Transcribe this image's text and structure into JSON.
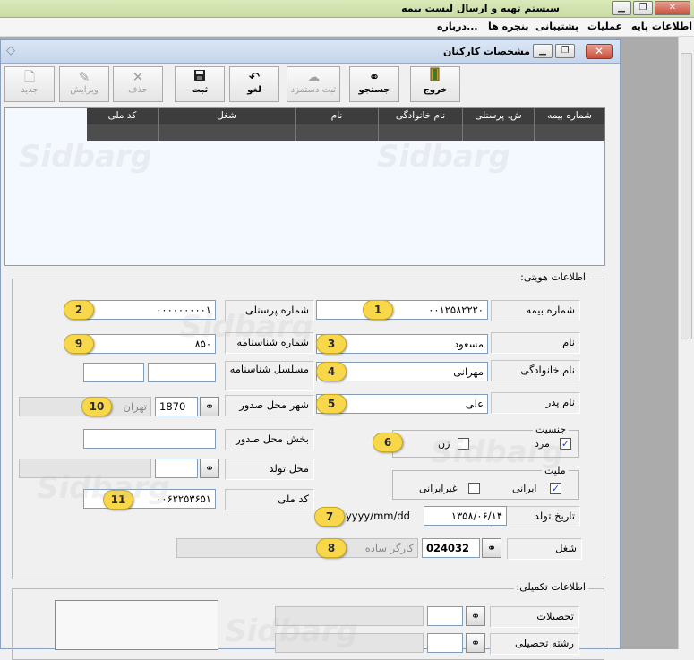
{
  "app": {
    "title": "سیستم تهیه و ارسال لیست بیمه",
    "window_controls": {
      "minimize": "▁",
      "restore": "❐",
      "close": "✕"
    }
  },
  "menu": {
    "items": [
      "اطلاعات پایه",
      "عملیات",
      "پشتیبانی",
      "پنجره ها",
      "درباره..."
    ]
  },
  "form": {
    "title": "مشخصات کارکنان",
    "controls": {
      "minimize": "▁",
      "restore": "❐",
      "close": "✕"
    }
  },
  "toolbar": {
    "exit": {
      "label": "خروج",
      "icon": "exit-door-icon"
    },
    "search": {
      "label": "جستجو",
      "icon": "binoculars-icon"
    },
    "temp_save": {
      "label": "ثبت دستمزد",
      "icon": "cloud-icon"
    },
    "undo": {
      "label": "لغو",
      "icon": "undo-icon"
    },
    "save": {
      "label": "ثبت",
      "icon": "floppy-disk-icon"
    },
    "delete": {
      "label": "حذف",
      "icon": "x-icon"
    },
    "edit": {
      "label": "ویرایش",
      "icon": "edit-icon"
    },
    "new": {
      "label": "جدید",
      "icon": "new-document-icon"
    }
  },
  "grid": {
    "columns": [
      "شماره بیمه",
      "ش. پرسنلی",
      "نام خانوادگی",
      "نام",
      "شغل",
      "کد ملی"
    ]
  },
  "identity": {
    "legend": "اطلاعات هویتی:",
    "insurance_no": {
      "label": "شماره بیمه",
      "value": "۰۰۱۲۵۸۲۲۲۰",
      "badge": "1"
    },
    "personnel_no": {
      "label": "شماره پرسنلی",
      "value": "۰۰۰۰۰۰۰۰۰۱",
      "badge": "2"
    },
    "first_name": {
      "label": "نام",
      "value": "مسعود",
      "badge": "3"
    },
    "birth_cert_no": {
      "label": "شماره شناسنامه",
      "value": "۸۵۰",
      "badge": "9"
    },
    "last_name": {
      "label": "نام خانوادگی",
      "value": "مهرانی",
      "badge": "4"
    },
    "cert_serial": {
      "label": "مسلسل شناسنامه"
    },
    "father_name": {
      "label": "نام پدر",
      "value": "علی",
      "badge": "5"
    },
    "issue_city": {
      "label": "شهر محل صدور",
      "code": "1870",
      "name": "تهران",
      "badge": "10"
    },
    "gender": {
      "legend": "جنسیت",
      "male": "مرد",
      "female": "زن",
      "male_checked": true,
      "female_checked": false,
      "badge": "6"
    },
    "issue_district": {
      "label": "بخش محل صدور"
    },
    "birth_place": {
      "label": "محل تولد"
    },
    "nationality": {
      "legend": "ملیت",
      "iranian": "ایرانی",
      "non_iranian": "غیرایرانی",
      "iranian_checked": true,
      "non_iranian_checked": false
    },
    "national_code": {
      "label": "کد ملی",
      "value": "۰۰۶۲۲۵۳۶۵۱",
      "badge": "11"
    },
    "birth_date": {
      "label": "تاریخ تولد",
      "value": "۱۳۵۸/۰۶/۱۴",
      "format_hint": "yyyy/mm/dd",
      "badge": "7"
    },
    "job": {
      "label": "شغل",
      "code": "024032",
      "name": "کارگر ساده",
      "badge": "8"
    }
  },
  "extra": {
    "legend": "اطلاعات تکمیلی:",
    "education": {
      "label": "تحصیلات"
    },
    "field_of_study": {
      "label": "رشته تحصیلی"
    }
  },
  "watermark": "Sidbarg"
}
